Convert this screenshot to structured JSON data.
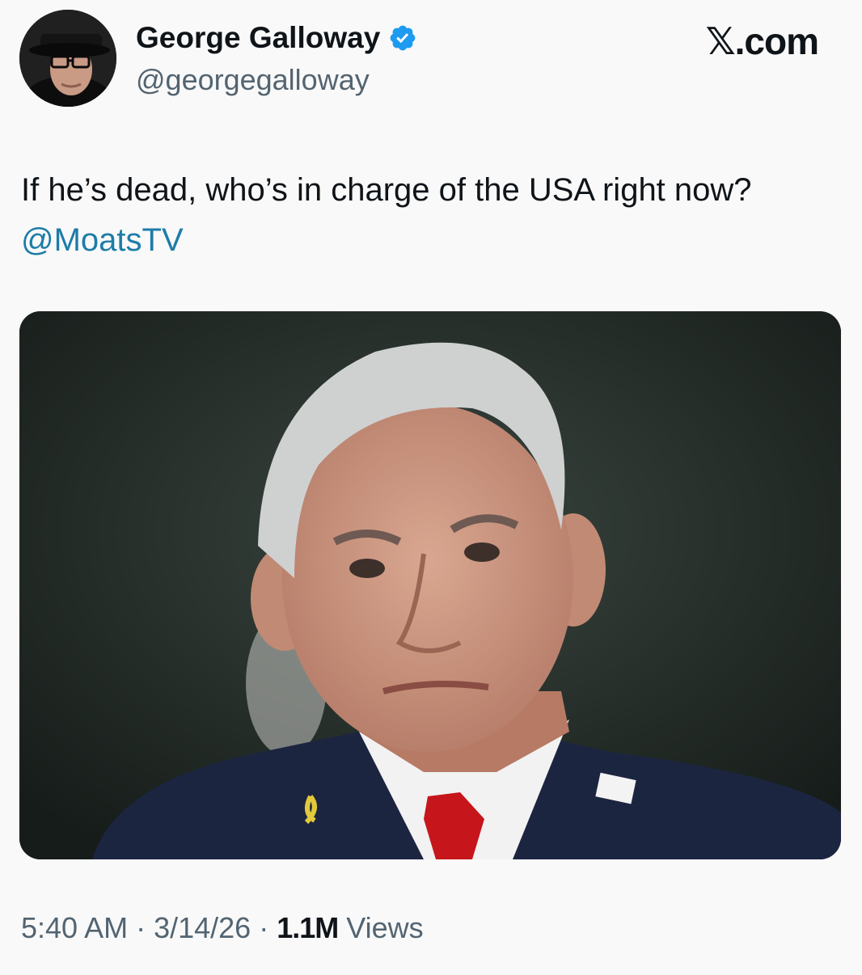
{
  "author": {
    "display_name": "George Galloway",
    "handle": "@georgegalloway",
    "verified": true,
    "avatar_icon": "profile-photo-man-in-hat-and-glasses"
  },
  "site": {
    "label": "𝕏.com"
  },
  "tweet": {
    "text": "If he’s dead, who’s in charge of the USA right now? ",
    "mention": "@MoatsTV",
    "media_description": "photo-older-man-grey-hair-dark-suit-red-tie"
  },
  "meta": {
    "time": "5:40 AM",
    "date": "3/14/26",
    "separator": "·",
    "views_count": "1.1M",
    "views_label": "Views"
  },
  "colors": {
    "mention": "#1d7ca8",
    "verified": "#1d9bf0",
    "secondary_text": "#536471"
  }
}
